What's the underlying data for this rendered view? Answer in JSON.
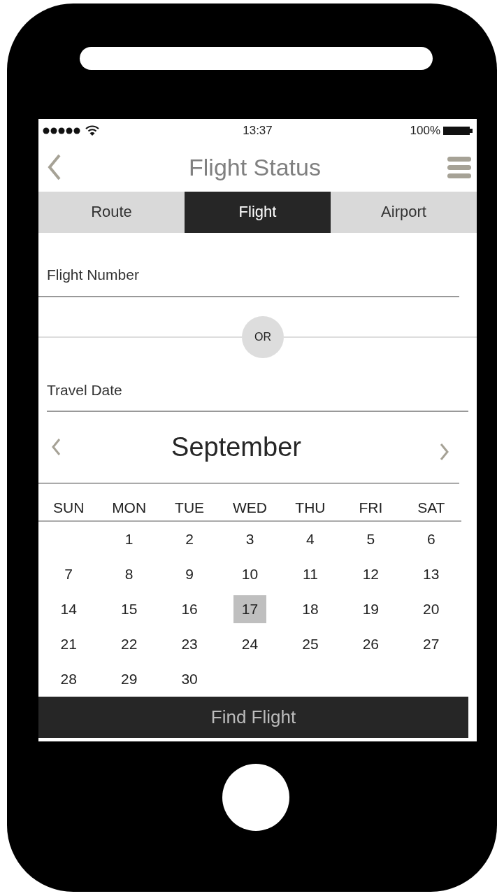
{
  "status_bar": {
    "time": "13:37",
    "battery": "100%"
  },
  "header": {
    "title": "Flight Status"
  },
  "tabs": [
    {
      "label": "Route",
      "selected": false
    },
    {
      "label": "Flight",
      "selected": true
    },
    {
      "label": "Airport",
      "selected": false
    }
  ],
  "flight_number": {
    "placeholder": "Flight Number"
  },
  "divider": {
    "label": "OR"
  },
  "travel_date": {
    "placeholder": "Travel Date"
  },
  "calendar": {
    "month": "September",
    "weekdays": [
      "SUN",
      "MON",
      "TUE",
      "WED",
      "THU",
      "FRI",
      "SAT"
    ],
    "weeks": [
      [
        {
          "label": "1",
          "selected": false
        },
        {
          "label": "2",
          "selected": false
        },
        {
          "label": "3",
          "selected": false
        },
        {
          "label": "4",
          "selected": false
        },
        {
          "label": "5",
          "selected": false
        },
        {
          "label": "6",
          "selected": false
        }
      ],
      [
        {
          "label": "7",
          "selected": false
        },
        {
          "label": "8",
          "selected": false
        },
        {
          "label": "9",
          "selected": false
        },
        {
          "label": "10",
          "selected": false
        },
        {
          "label": "11",
          "selected": false
        },
        {
          "label": "12",
          "selected": false
        },
        {
          "label": "13",
          "selected": false
        }
      ],
      [
        {
          "label": "14",
          "selected": false
        },
        {
          "label": "15",
          "selected": false
        },
        {
          "label": "16",
          "selected": false
        },
        {
          "label": "17",
          "selected": true
        },
        {
          "label": "18",
          "selected": false
        },
        {
          "label": "19",
          "selected": false
        },
        {
          "label": "20",
          "selected": false
        }
      ],
      [
        {
          "label": "21",
          "selected": false
        },
        {
          "label": "22",
          "selected": false
        },
        {
          "label": "23",
          "selected": false
        },
        {
          "label": "24",
          "selected": false
        },
        {
          "label": "25",
          "selected": false
        },
        {
          "label": "26",
          "selected": false
        },
        {
          "label": "27",
          "selected": false
        }
      ],
      [
        {
          "label": "28",
          "selected": false
        },
        {
          "label": "29",
          "selected": false
        },
        {
          "label": "30",
          "selected": false
        }
      ]
    ]
  },
  "button": {
    "label": "Find Flight"
  }
}
